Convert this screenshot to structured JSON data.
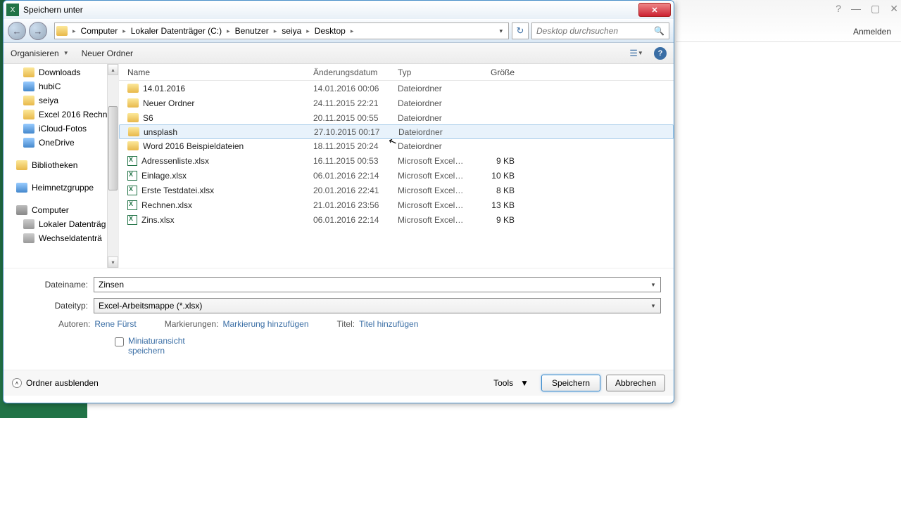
{
  "window": {
    "title": "Speichern unter",
    "anmelden": "Anmelden"
  },
  "nav": {
    "path": [
      "Computer",
      "Lokaler Datenträger (C:)",
      "Benutzer",
      "seiya",
      "Desktop"
    ],
    "search_placeholder": "Desktop durchsuchen"
  },
  "toolbar": {
    "organisieren": "Organisieren",
    "neuer_ordner": "Neuer Ordner"
  },
  "tree": [
    {
      "label": "Downloads",
      "ico": "ico-folder",
      "lvl": 2
    },
    {
      "label": "hubiC",
      "ico": "ico-blue",
      "lvl": 2
    },
    {
      "label": "seiya",
      "ico": "ico-folder",
      "lvl": 2
    },
    {
      "label": "Excel 2016 Rechn",
      "ico": "ico-folder",
      "lvl": 2
    },
    {
      "label": "iCloud-Fotos",
      "ico": "ico-blue",
      "lvl": 2
    },
    {
      "label": "OneDrive",
      "ico": "ico-blue",
      "lvl": 2
    },
    {
      "label": "",
      "spacer": true
    },
    {
      "label": "Bibliotheken",
      "ico": "ico-folder",
      "lvl": 1
    },
    {
      "label": "",
      "spacer": true
    },
    {
      "label": "Heimnetzgruppe",
      "ico": "ico-blue",
      "lvl": 1
    },
    {
      "label": "",
      "spacer": true
    },
    {
      "label": "Computer",
      "ico": "ico-computer",
      "lvl": 1
    },
    {
      "label": "Lokaler Datenträg",
      "ico": "ico-drive",
      "lvl": 2
    },
    {
      "label": "Wechseldatenträ",
      "ico": "ico-drive",
      "lvl": 2
    }
  ],
  "columns": {
    "name": "Name",
    "date": "Änderungsdatum",
    "type": "Typ",
    "size": "Größe"
  },
  "files": [
    {
      "name": "14.01.2016",
      "date": "14.01.2016 00:06",
      "type": "Dateiordner",
      "size": "",
      "ico": "ico-fd"
    },
    {
      "name": "Neuer Ordner",
      "date": "24.11.2015 22:21",
      "type": "Dateiordner",
      "size": "",
      "ico": "ico-fd"
    },
    {
      "name": "S6",
      "date": "20.11.2015 00:55",
      "type": "Dateiordner",
      "size": "",
      "ico": "ico-fd"
    },
    {
      "name": "unsplash",
      "date": "27.10.2015 00:17",
      "type": "Dateiordner",
      "size": "",
      "ico": "ico-fd",
      "hov": true
    },
    {
      "name": "Word 2016 Beispieldateien",
      "date": "18.11.2015 20:24",
      "type": "Dateiordner",
      "size": "",
      "ico": "ico-fd"
    },
    {
      "name": "Adressenliste.xlsx",
      "date": "16.11.2015 00:53",
      "type": "Microsoft Excel-Ar...",
      "size": "9 KB",
      "ico": "ico-xl"
    },
    {
      "name": "Einlage.xlsx",
      "date": "06.01.2016 22:14",
      "type": "Microsoft Excel-Ar...",
      "size": "10 KB",
      "ico": "ico-xl"
    },
    {
      "name": "Erste Testdatei.xlsx",
      "date": "20.01.2016 22:41",
      "type": "Microsoft Excel-Ar...",
      "size": "8 KB",
      "ico": "ico-xl"
    },
    {
      "name": "Rechnen.xlsx",
      "date": "21.01.2016 23:56",
      "type": "Microsoft Excel-Ar...",
      "size": "13 KB",
      "ico": "ico-xl"
    },
    {
      "name": "Zins.xlsx",
      "date": "06.01.2016 22:14",
      "type": "Microsoft Excel-Ar...",
      "size": "9 KB",
      "ico": "ico-xl"
    }
  ],
  "fields": {
    "filename_label": "Dateiname:",
    "filename_value": "Zinsen",
    "filetype_label": "Dateityp:",
    "filetype_value": "Excel-Arbeitsmappe (*.xlsx)",
    "authors_label": "Autoren:",
    "authors_value": "Rene Fürst",
    "tags_label": "Markierungen:",
    "tags_value": "Markierung hinzufügen",
    "title_label": "Titel:",
    "title_value": "Titel hinzufügen",
    "thumb_label": "Miniaturansicht speichern"
  },
  "buttons": {
    "hide_folders": "Ordner ausblenden",
    "tools": "Tools",
    "save": "Speichern",
    "cancel": "Abbrechen"
  }
}
